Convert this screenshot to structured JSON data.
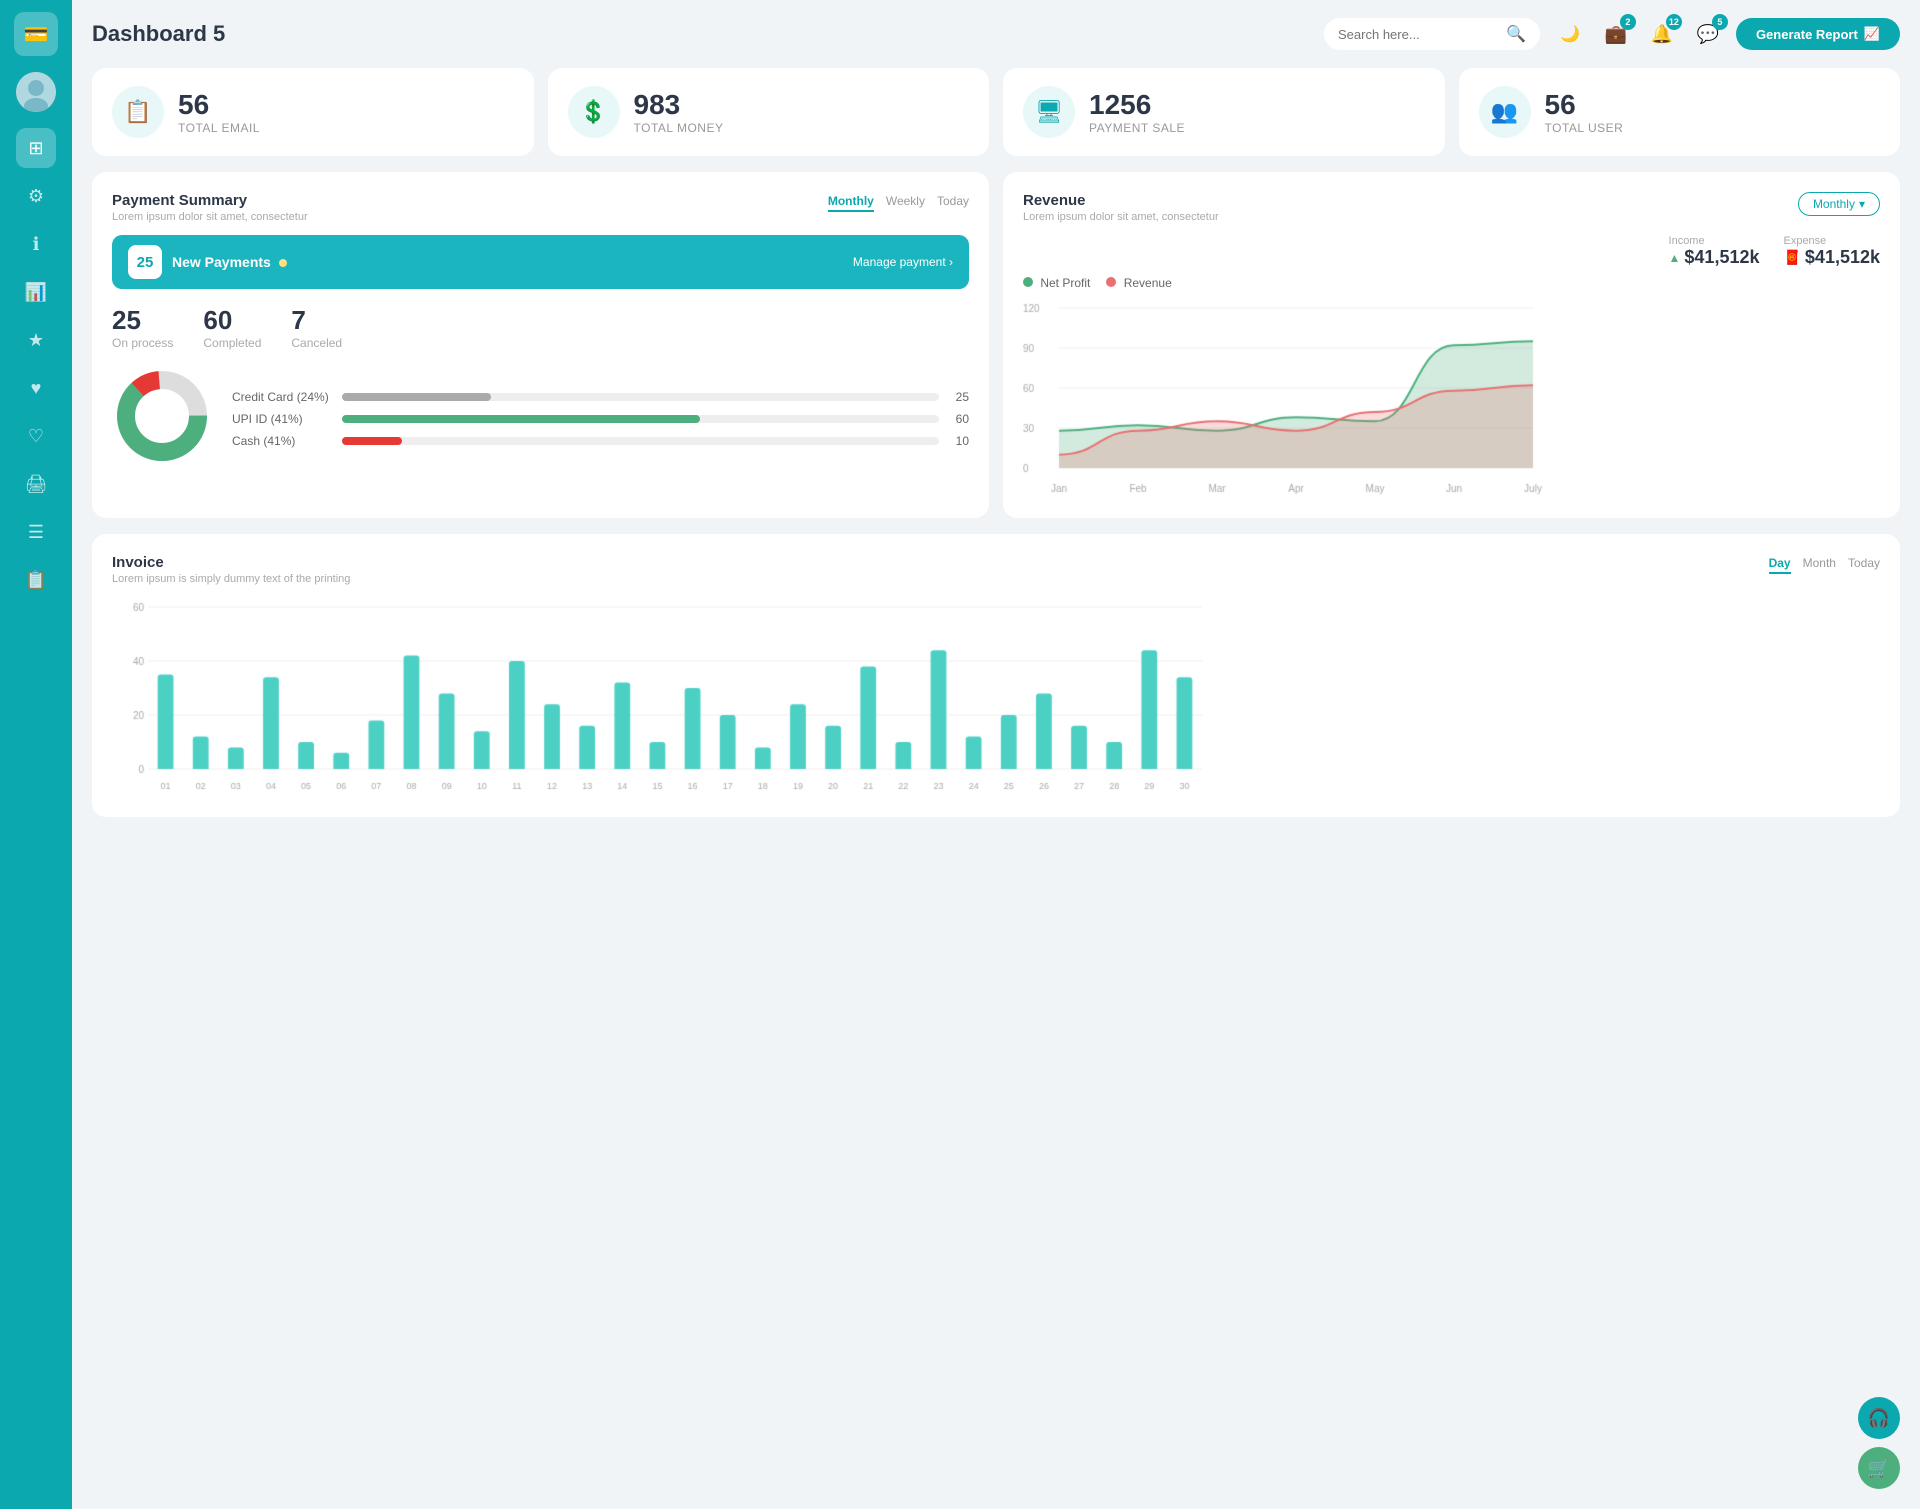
{
  "sidebar": {
    "logo_icon": "💳",
    "items": [
      {
        "id": "avatar",
        "icon": "👤",
        "active": false
      },
      {
        "id": "dashboard",
        "icon": "⊞",
        "active": true
      },
      {
        "id": "settings",
        "icon": "⚙",
        "active": false
      },
      {
        "id": "info",
        "icon": "ℹ",
        "active": false
      },
      {
        "id": "chart",
        "icon": "📊",
        "active": false
      },
      {
        "id": "star",
        "icon": "★",
        "active": false
      },
      {
        "id": "heart1",
        "icon": "♥",
        "active": false
      },
      {
        "id": "heart2",
        "icon": "♡",
        "active": false
      },
      {
        "id": "print",
        "icon": "🖨",
        "active": false
      },
      {
        "id": "list",
        "icon": "☰",
        "active": false
      },
      {
        "id": "doc",
        "icon": "📋",
        "active": false
      }
    ]
  },
  "header": {
    "title": "Dashboard 5",
    "search_placeholder": "Search here...",
    "badge_wallet": "2",
    "badge_bell": "12",
    "badge_chat": "5",
    "generate_btn": "Generate Report"
  },
  "stat_cards": [
    {
      "id": "email",
      "num": "56",
      "label": "TOTAL EMAIL",
      "icon": "📋"
    },
    {
      "id": "money",
      "num": "983",
      "label": "TOTAL MONEY",
      "icon": "💲"
    },
    {
      "id": "payment",
      "num": "1256",
      "label": "PAYMENT SALE",
      "icon": "🖥"
    },
    {
      "id": "user",
      "num": "56",
      "label": "TOTAL USER",
      "icon": "👥"
    }
  ],
  "payment_summary": {
    "title": "Payment Summary",
    "subtitle": "Lorem ipsum dolor sit amet, consectetur",
    "tabs": [
      "Monthly",
      "Weekly",
      "Today"
    ],
    "active_tab": "Monthly",
    "new_payments_count": "25",
    "new_payments_label": "New Payments",
    "manage_link": "Manage payment",
    "on_process": "25",
    "on_process_label": "On process",
    "completed": "60",
    "completed_label": "Completed",
    "canceled": "7",
    "canceled_label": "Canceled",
    "progress_rows": [
      {
        "label": "Credit Card (24%)",
        "value": 25,
        "color": "#aaa",
        "max": 100
      },
      {
        "label": "UPI ID (41%)",
        "value": 60,
        "color": "#4caf7d",
        "max": 100
      },
      {
        "label": "Cash (41%)",
        "value": 10,
        "color": "#e53935",
        "max": 100
      }
    ],
    "donut_segments": [
      {
        "color": "#e53935",
        "value": 10
      },
      {
        "color": "#4caf7d",
        "value": 60
      },
      {
        "color": "#ddd",
        "value": 25
      }
    ]
  },
  "revenue": {
    "title": "Revenue",
    "subtitle": "Lorem ipsum dolor sit amet, consectetur",
    "tab_label": "Monthly",
    "income_label": "Income",
    "income_value": "$41,512k",
    "expense_label": "Expense",
    "expense_value": "$41,512k",
    "legend_net_profit": "Net Profit",
    "legend_revenue": "Revenue",
    "months": [
      "Jan",
      "Feb",
      "Mar",
      "Apr",
      "May",
      "Jun",
      "July"
    ],
    "y_labels": [
      "0",
      "30",
      "60",
      "90",
      "120"
    ],
    "net_profit_data": [
      28,
      32,
      28,
      38,
      35,
      92,
      95
    ],
    "revenue_data": [
      10,
      28,
      35,
      28,
      42,
      58,
      62
    ]
  },
  "invoice": {
    "title": "Invoice",
    "subtitle": "Lorem ipsum is simply dummy text of the printing",
    "tabs": [
      "Day",
      "Month",
      "Today"
    ],
    "active_tab": "Day",
    "x_labels": [
      "01",
      "02",
      "03",
      "04",
      "05",
      "06",
      "07",
      "08",
      "09",
      "10",
      "11",
      "12",
      "13",
      "14",
      "15",
      "16",
      "17",
      "18",
      "19",
      "20",
      "21",
      "22",
      "23",
      "24",
      "25",
      "26",
      "27",
      "28",
      "29",
      "30"
    ],
    "y_labels": [
      "0",
      "20",
      "40",
      "60"
    ],
    "bar_data": [
      35,
      12,
      8,
      34,
      10,
      6,
      18,
      42,
      28,
      14,
      40,
      24,
      16,
      32,
      10,
      30,
      20,
      8,
      24,
      16,
      38,
      10,
      44,
      12,
      20,
      28,
      16,
      10,
      44,
      34
    ]
  },
  "colors": {
    "primary": "#0ca8b0",
    "green": "#4caf7d",
    "red": "#e53935",
    "bar": "#4dd0c4"
  },
  "float_btns": [
    {
      "id": "headset",
      "icon": "🎧",
      "color": "teal"
    },
    {
      "id": "cart",
      "icon": "🛒",
      "color": "green"
    }
  ]
}
